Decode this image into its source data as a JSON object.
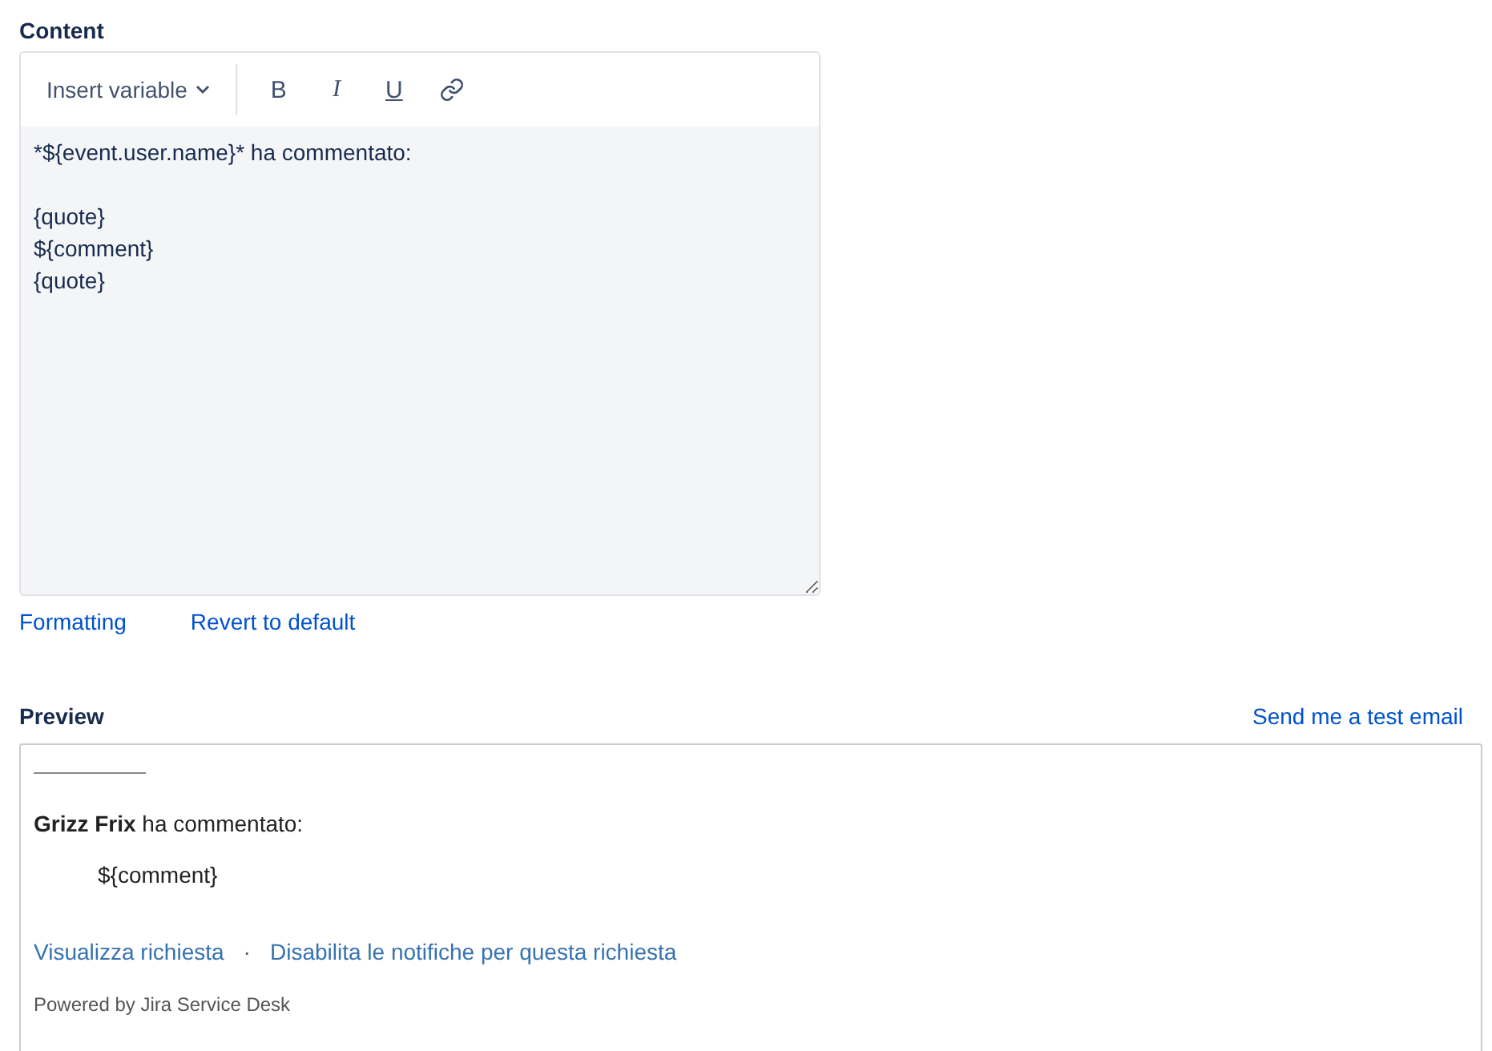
{
  "content": {
    "label": "Content",
    "toolbar": {
      "insert_variable": "Insert variable",
      "format_buttons": [
        {
          "kind": "bold",
          "label": "B"
        },
        {
          "kind": "italic",
          "label": "I"
        },
        {
          "kind": "underline",
          "label": "U"
        },
        {
          "kind": "link"
        }
      ]
    },
    "editor_value": "*${event.user.name}* ha commentato:\n\n{quote}\n${comment}\n{quote}",
    "links": [
      "Formatting",
      "Revert to default"
    ]
  },
  "preview": {
    "label": "Preview",
    "test_email_link": "Send me a test email",
    "lines": [
      {
        "kind": "rule"
      },
      {
        "kind": "text",
        "text": "**Grizz Frix** ha commentato:"
      },
      {
        "kind": "quote",
        "text": "${comment}"
      }
    ],
    "links": [
      "Visualizza richiesta",
      "Disabilita le notifiche per questa richiesta"
    ],
    "separator": "·",
    "footer": "Powered by Jira Service Desk"
  }
}
